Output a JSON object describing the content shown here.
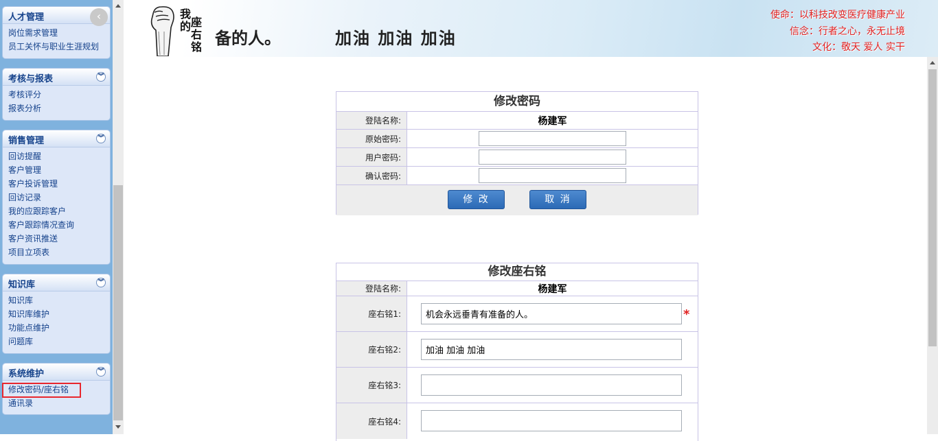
{
  "sidebar": {
    "collapse_icon": "chevron-left-icon",
    "panels": [
      {
        "title": "人才管理",
        "items": [
          "岗位需求管理",
          "员工关怀与职业生涯规划"
        ]
      },
      {
        "title": "考核与报表",
        "items": [
          "考核评分",
          "报表分析"
        ]
      },
      {
        "title": "销售管理",
        "items": [
          "回访提醒",
          "客户管理",
          "客户投诉管理",
          "回访记录",
          "我的应跟踪客户",
          "客户跟踪情况查询",
          "客户资讯推送",
          "项目立项表"
        ]
      },
      {
        "title": "知识库",
        "items": [
          "知识库",
          "知识库维护",
          "功能点维护",
          "问题库"
        ]
      },
      {
        "title": "系统维护",
        "items": [
          "修改密码/座右铭",
          "通讯录"
        ]
      }
    ]
  },
  "banner": {
    "vertical_1": "我的",
    "vertical_2": "座右铭",
    "motto_1_partial": "备的人。",
    "motto_2": "加油 加油 加油",
    "mission": "使命：以科技改变医疗健康产业",
    "belief": "信念：行者之心，永无止境",
    "culture": "文化：敬天 爱人 实干"
  },
  "password_form": {
    "title": "修改密码",
    "login_label": "登陆名称:",
    "login_name": "杨建军",
    "old_pwd_label": "原始密码:",
    "new_pwd_label": "用户密码:",
    "confirm_pwd_label": "确认密码:",
    "submit_label": "修 改",
    "cancel_label": "取 消"
  },
  "motto_form": {
    "title": "修改座右铭",
    "login_label": "登陆名称:",
    "login_name": "杨建军",
    "motto1_label": "座右铭1:",
    "motto1_value": "机会永远垂青有准备的人。",
    "required_mark": "*",
    "motto2_label": "座右铭2:",
    "motto2_value": "加油 加油 加油",
    "motto3_label": "座右铭3:",
    "motto3_value": "",
    "motto4_label": "座右铭4:",
    "motto4_value": ""
  }
}
